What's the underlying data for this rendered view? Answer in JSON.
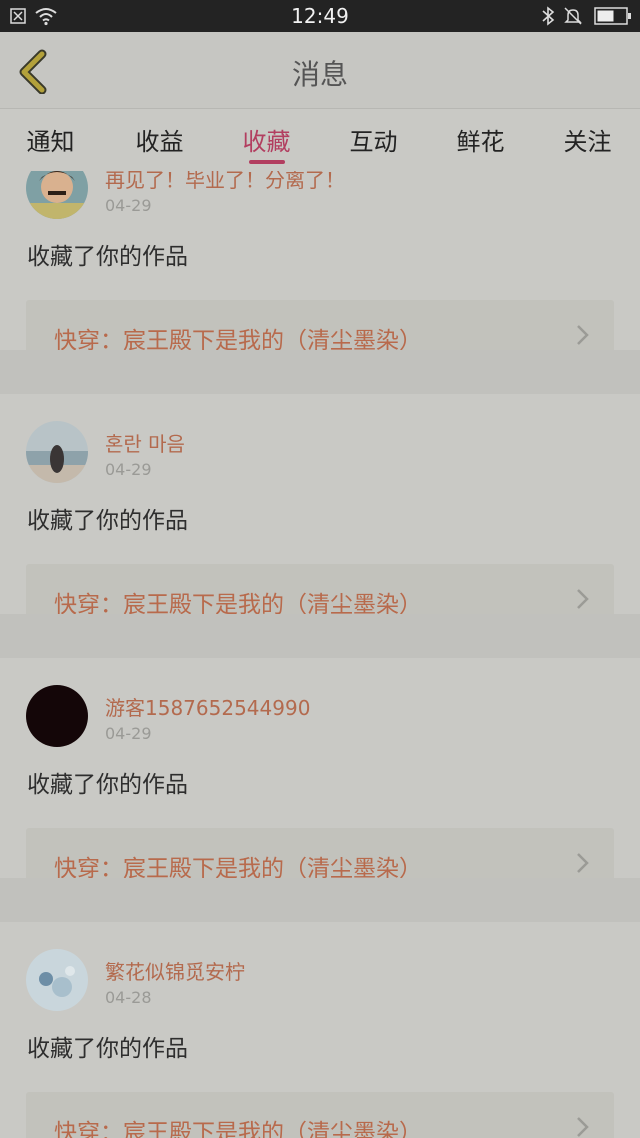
{
  "status_bar": {
    "time": "12:49",
    "icons": [
      "close-box-icon",
      "wifi-icon",
      "bluetooth-icon",
      "muted-bell-icon",
      "battery-icon"
    ]
  },
  "header": {
    "title": "消息",
    "back_icon": "chevron-left-icon"
  },
  "tabs": [
    {
      "label": "通知",
      "active": false
    },
    {
      "label": "收益",
      "active": false
    },
    {
      "label": "收藏",
      "active": true
    },
    {
      "label": "互动",
      "active": false
    },
    {
      "label": "鲜花",
      "active": false
    },
    {
      "label": "关注",
      "active": false
    }
  ],
  "messages": [
    {
      "username": "再见了！毕业了！分离了！",
      "date": "04-29",
      "action": "收藏了你的作品",
      "work_title": "快穿：宸王殿下是我的（清尘墨染）"
    },
    {
      "username": "혼란 마음",
      "date": "04-29",
      "action": "收藏了你的作品",
      "work_title": "快穿：宸王殿下是我的（清尘墨染）"
    },
    {
      "username": "游客1587652544990",
      "date": "04-29",
      "action": "收藏了你的作品",
      "work_title": "快穿：宸王殿下是我的（清尘墨染）"
    },
    {
      "username": "繁花似锦觅安柠",
      "date": "04-28",
      "action": "收藏了你的作品",
      "work_title": "快穿：宸王殿下是我的（清尘墨染）"
    }
  ],
  "colors": {
    "accent": "#b23e60",
    "username": "#b36a4e",
    "work_title": "#b86a4c"
  }
}
